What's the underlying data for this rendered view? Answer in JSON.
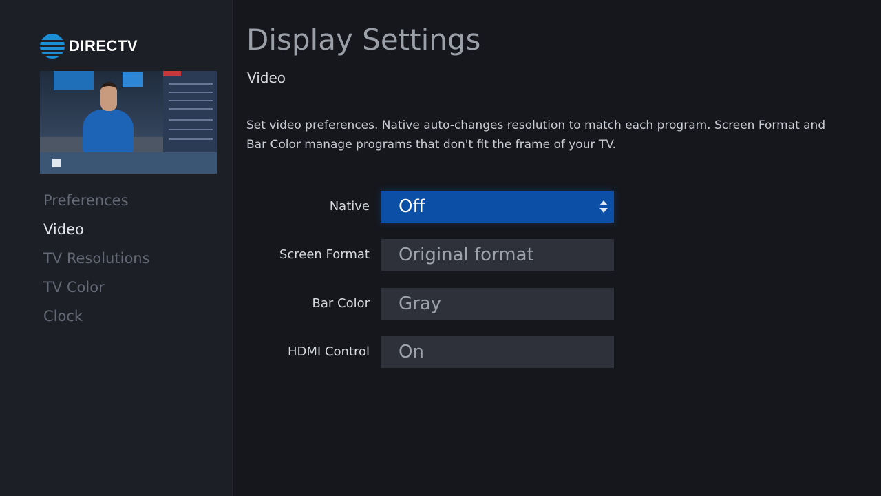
{
  "brand": {
    "logo_text": "DIRECTV"
  },
  "sidebar": {
    "items": [
      {
        "label": "Preferences"
      },
      {
        "label": "Video"
      },
      {
        "label": "TV Resolutions"
      },
      {
        "label": "TV Color"
      },
      {
        "label": "Clock"
      }
    ],
    "active_index": 1
  },
  "main": {
    "title": "Display Settings",
    "section": "Video",
    "description": "Set video preferences. Native auto-changes resolution to match each program. Screen Format and Bar Color manage programs that don't fit the frame of your TV.",
    "settings": [
      {
        "label": "Native",
        "value": "Off"
      },
      {
        "label": "Screen Format",
        "value": "Original format"
      },
      {
        "label": "Bar Color",
        "value": "Gray"
      },
      {
        "label": "HDMI Control",
        "value": "On"
      }
    ],
    "selected_setting": "Native"
  },
  "colors": {
    "background": "#15171c",
    "sidebar": "#1c1f26",
    "selected_value": "#0b4fa6",
    "value_box": "#2e3139",
    "brand_blue": "#1a8fd6"
  },
  "icons": {
    "logo": "att-globe-icon",
    "selector": "up-down-arrows-icon"
  }
}
